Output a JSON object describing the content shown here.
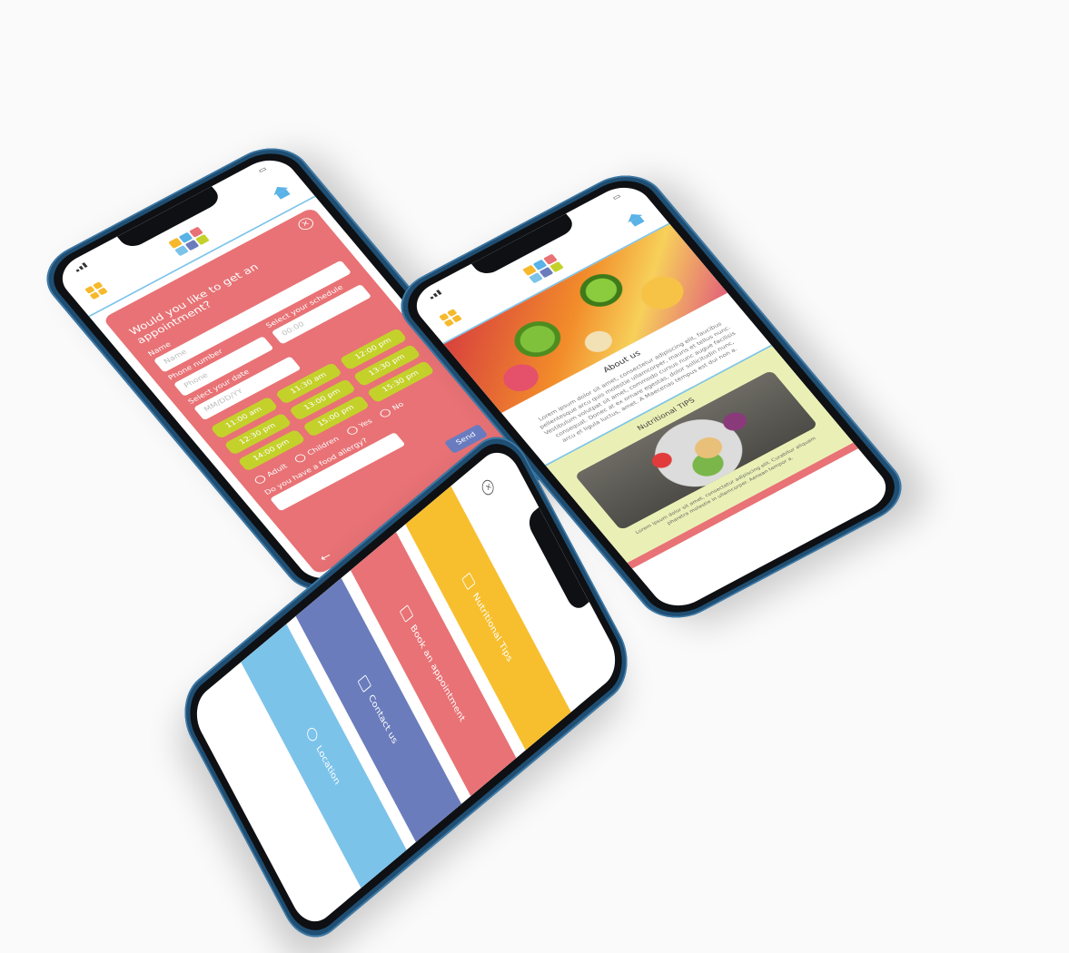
{
  "form": {
    "title": "Would you like to get an appointment?",
    "name_label": "Name",
    "name_placeholder": "Name",
    "phone_label": "Phone number",
    "phone_placeholder": "Phone",
    "schedule_label": "Select your schedule",
    "schedule_placeholder": "00:00",
    "date_label": "Select your date",
    "date_placeholder": "MM/DD/YY",
    "slots": [
      "11:00 am",
      "11:30 am",
      "12:00 pm",
      "12:30 pm",
      "13:00 pm",
      "13:30 pm",
      "14:00 pm",
      "15:00 pm",
      "15:30 pm"
    ],
    "adult_label": "Adult",
    "children_label": "Children",
    "yes_label": "Yes",
    "no_label": "No",
    "allergy_label": "Do you have a food allergy?",
    "send_label": "Send"
  },
  "info": {
    "about_title": "About us",
    "about_text": "Lorem ipsum dolor sit amet, consectetur adipiscing elit, faucibus pellentesque arcu quis molestie ullamcorper, mauris et tellus nunc. Vestibulum volutpat sit amet, commodo cursus nunc augue facilisis consequat. Donec at ex ornare egestas, dolor sollicitudin nunc, arcu et ligula luctus, amet. A Maecenas tempus est dui non a.",
    "tips_title": "Nutritional TIPS",
    "tips_text": "Lorem ipsum dolor sit amet, consectetur adipiscing elit. Curabitur aliquam pharetra molestie in ullamcorper. Aenean tempor a.",
    "colors": {
      "accent_blue": "#7cc3ea",
      "pink": "#e87275",
      "tips_bg": "#eaf0b5"
    }
  },
  "menu": {
    "items": [
      {
        "label": "Nutritional Tips",
        "color": "#f7bf2e",
        "icon": "lightbulb-icon"
      },
      {
        "label": "Book an appointment",
        "color": "#e87275",
        "icon": "calendar-icon"
      },
      {
        "label": "Contact us",
        "color": "#6a7cbc",
        "icon": "mail-icon"
      },
      {
        "label": "Location",
        "color": "#7cc3ea",
        "icon": "location-pin-icon"
      }
    ]
  },
  "logo_colors": [
    "#f6b92b",
    "#5ab2e6",
    "#e87275",
    "#7cc3ea",
    "#6a7cbc",
    "#c4d12b"
  ]
}
